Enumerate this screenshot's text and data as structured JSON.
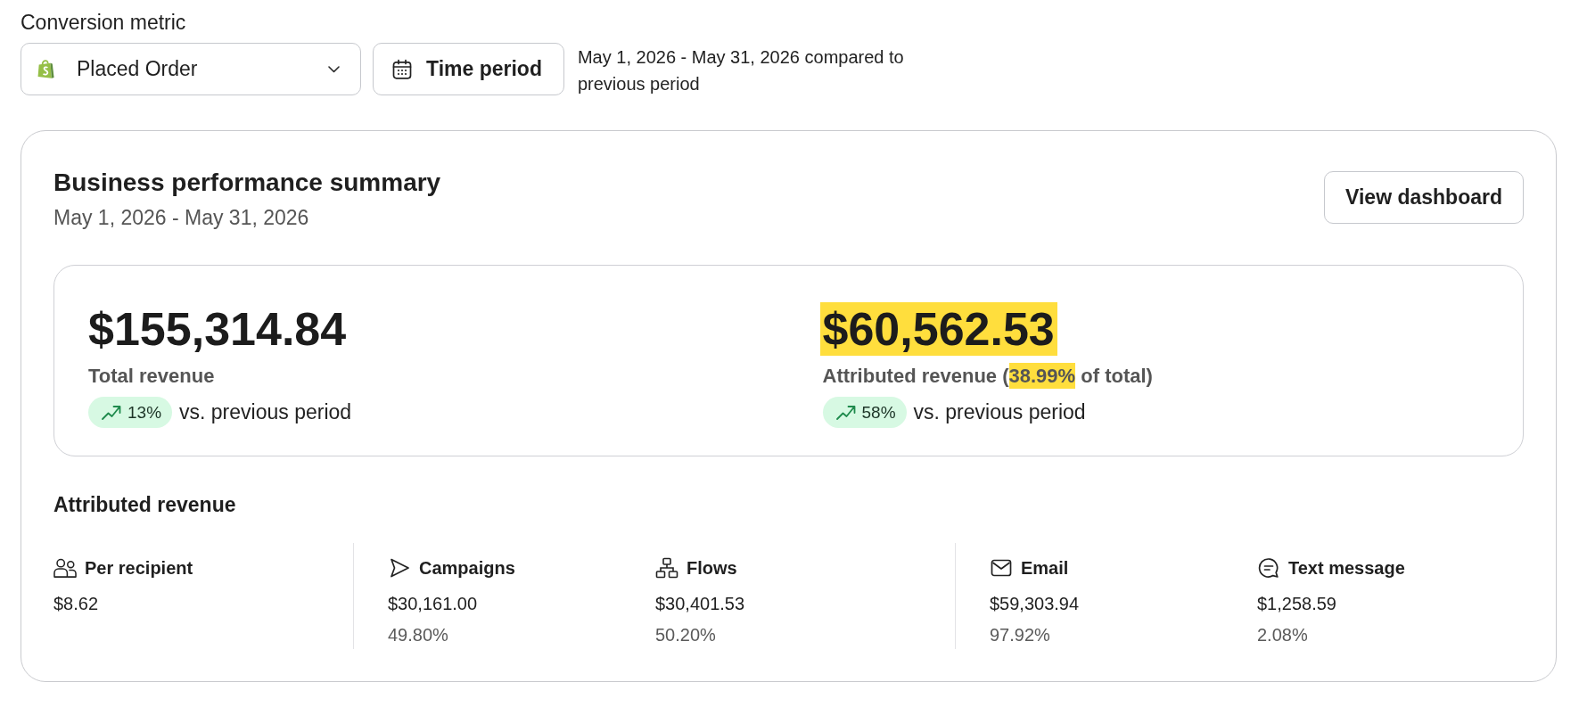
{
  "conversion_metric": {
    "label": "Conversion metric",
    "value": "Placed Order"
  },
  "time_period": {
    "button": "Time period",
    "description": "May 1, 2026 - May 31, 2026 compared to previous period"
  },
  "summary": {
    "title": "Business performance summary",
    "date_range": "May 1, 2026 - May 31, 2026",
    "button": "View dashboard",
    "kpis": [
      {
        "value": "$155,314.84",
        "highlighted": false,
        "label": [
          {
            "text": "Total revenue",
            "highlighted": false
          }
        ],
        "change": "13%",
        "rising": true,
        "comparison": "vs. previous period"
      },
      {
        "value": "$60,562.53",
        "highlighted": true,
        "label": [
          {
            "text": "Attributed revenue (",
            "highlighted": false
          },
          {
            "text": "38.99%",
            "highlighted": true
          },
          {
            "text": " of total)",
            "highlighted": false
          }
        ],
        "change": "58%",
        "rising": true,
        "comparison": "vs. previous period"
      }
    ]
  },
  "attributed_revenue": {
    "title": "Attributed revenue",
    "groups": [
      {
        "metrics": [
          {
            "label": "Per recipient",
            "value": "$8.62"
          }
        ]
      },
      {
        "metrics": [
          {
            "label": "Campaigns",
            "value": "$30,161.00",
            "share": "49.80%"
          },
          {
            "label": "Flows",
            "value": "$30,401.53",
            "share": "50.20%"
          }
        ]
      },
      {
        "metrics": [
          {
            "label": "Email",
            "value": "$59,303.94",
            "share": "97.92%"
          },
          {
            "label": "Text message",
            "value": "$1,258.59",
            "share": "2.08%"
          }
        ]
      }
    ]
  }
}
